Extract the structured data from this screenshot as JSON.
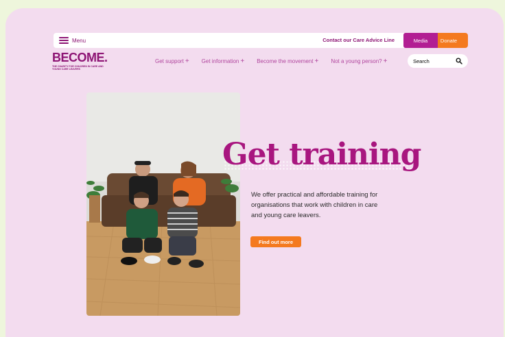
{
  "topbar": {
    "menu_label": "Menu",
    "contact_label": "Contact our Care Advice Line",
    "media_label": "Media",
    "donate_label": "Donate"
  },
  "logo": {
    "wordmark": "BECOME.",
    "tagline": "THE CHARITY FOR CHILDREN IN CARE AND YOUNG CARE LEAVERS"
  },
  "nav": {
    "items": [
      {
        "label": "Get support"
      },
      {
        "label": "Get information"
      },
      {
        "label": "Become the movement"
      },
      {
        "label": "Not a young person?"
      }
    ],
    "plus": "+"
  },
  "search": {
    "placeholder": "Search",
    "icon": "search-icon"
  },
  "hero": {
    "headline": "Get training",
    "body": "We offer practical and affordable training for organisations that work with children in care and young care leavers.",
    "cta_label": "Find out more"
  },
  "colors": {
    "brand": "#8d1474",
    "accent": "#f47a1f",
    "background": "#f3dcef"
  }
}
